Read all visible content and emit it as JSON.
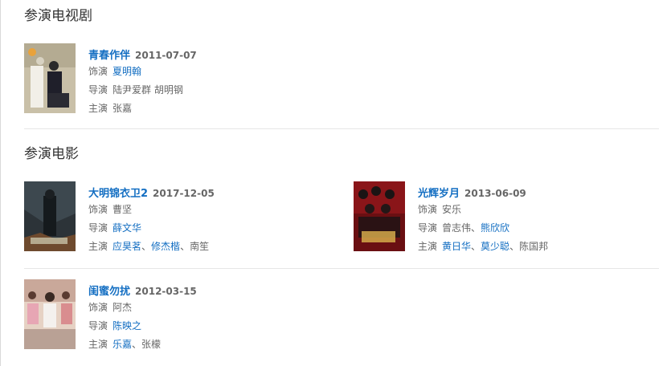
{
  "sections": {
    "tv": {
      "title": "参演电视剧"
    },
    "movies": {
      "title": "参演电影"
    }
  },
  "labels": {
    "role": "饰演",
    "director": "导演",
    "cast": "主演",
    "sep": "、"
  },
  "items": {
    "qingchun": {
      "title": "青春作伴",
      "date": "2011-07-07",
      "role": "夏明翰",
      "director": "陆尹爱群 胡明钢",
      "cast": "张嘉"
    },
    "daming": {
      "title": "大明锦衣卫2",
      "date": "2017-12-05",
      "role": "曹坚",
      "director": "薛文华",
      "cast": [
        "应昊茗",
        "修杰楷",
        "南笙"
      ]
    },
    "guanghui": {
      "title": "光辉岁月",
      "date": "2013-06-09",
      "role": "安乐",
      "director": [
        "曾志伟",
        "熊欣欣"
      ],
      "cast": [
        "黄日华",
        "莫少聪",
        "陈国邦"
      ]
    },
    "guimi": {
      "title": "闺蜜勿扰",
      "date": "2012-03-15",
      "role": "阿杰",
      "director": "陈映之",
      "cast": [
        "乐嘉",
        "张檬"
      ]
    }
  },
  "colors": {
    "link": "#136ec2",
    "muted": "#666666",
    "divider": "#e6e6e6"
  }
}
